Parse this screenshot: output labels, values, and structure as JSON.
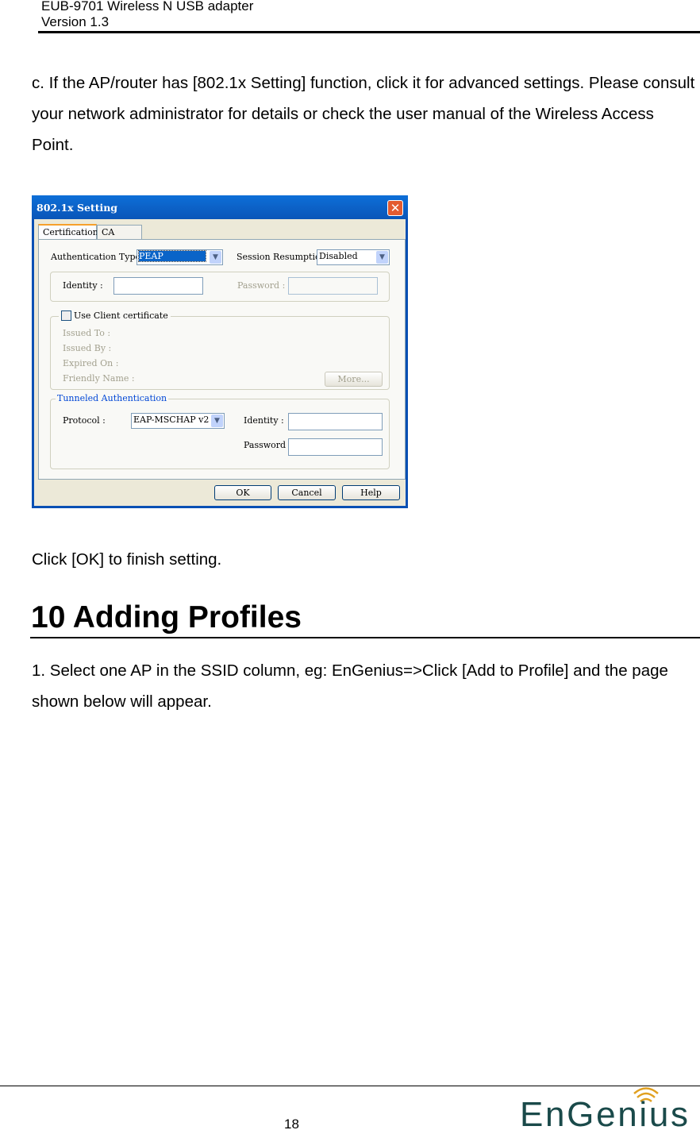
{
  "header": {
    "product": "EUB-9701 Wireless N USB adapter",
    "version": "Version 1.3"
  },
  "body": {
    "para_c": "c. If the AP/router has [802.1x Setting] function, click it for advanced settings. Please consult your network administrator for details or check the user manual of the Wireless Access Point.",
    "para_ok": "Click [OK] to finish setting.",
    "heading": "10 Adding Profiles",
    "para_1": "1. Select one AP in the SSID column, eg: EnGenius=>Click [Add to Profile] and the page shown below will appear."
  },
  "dialog": {
    "title": "802.1x Setting",
    "close_icon": "close-icon",
    "tabs": [
      {
        "label": "Certification",
        "active": true
      },
      {
        "label": "CA Server",
        "active": false
      }
    ],
    "auth_type_label": "Authentication Type:",
    "auth_type_value": "PEAP",
    "session_label": "Session Resumption:",
    "session_value": "Disabled",
    "identity_label": "Identity :",
    "identity_value": "",
    "password_label": "Password :",
    "password_value": "",
    "use_client_cert_label": "Use Client certificate",
    "use_client_cert_checked": false,
    "issued_to": "Issued To :",
    "issued_by": "Issued By :",
    "expired_on": "Expired On :",
    "friendly_name": "Friendly Name :",
    "more_button": "More...",
    "tunneled_legend": "Tunneled Authentication",
    "protocol_label": "Protocol :",
    "protocol_value": "EAP-MSCHAP v2",
    "t_identity_label": "Identity :",
    "t_password_label": "Password :",
    "ok": "OK",
    "cancel": "Cancel",
    "help": "Help"
  },
  "footer": {
    "page_number": "18",
    "logo": "EnGenius"
  },
  "colors": {
    "titlebar": "#0a5fc8",
    "tunneled_legend": "#0046d5",
    "logo_text": "#1a4a4a",
    "logo_waves": "#e0a020"
  }
}
